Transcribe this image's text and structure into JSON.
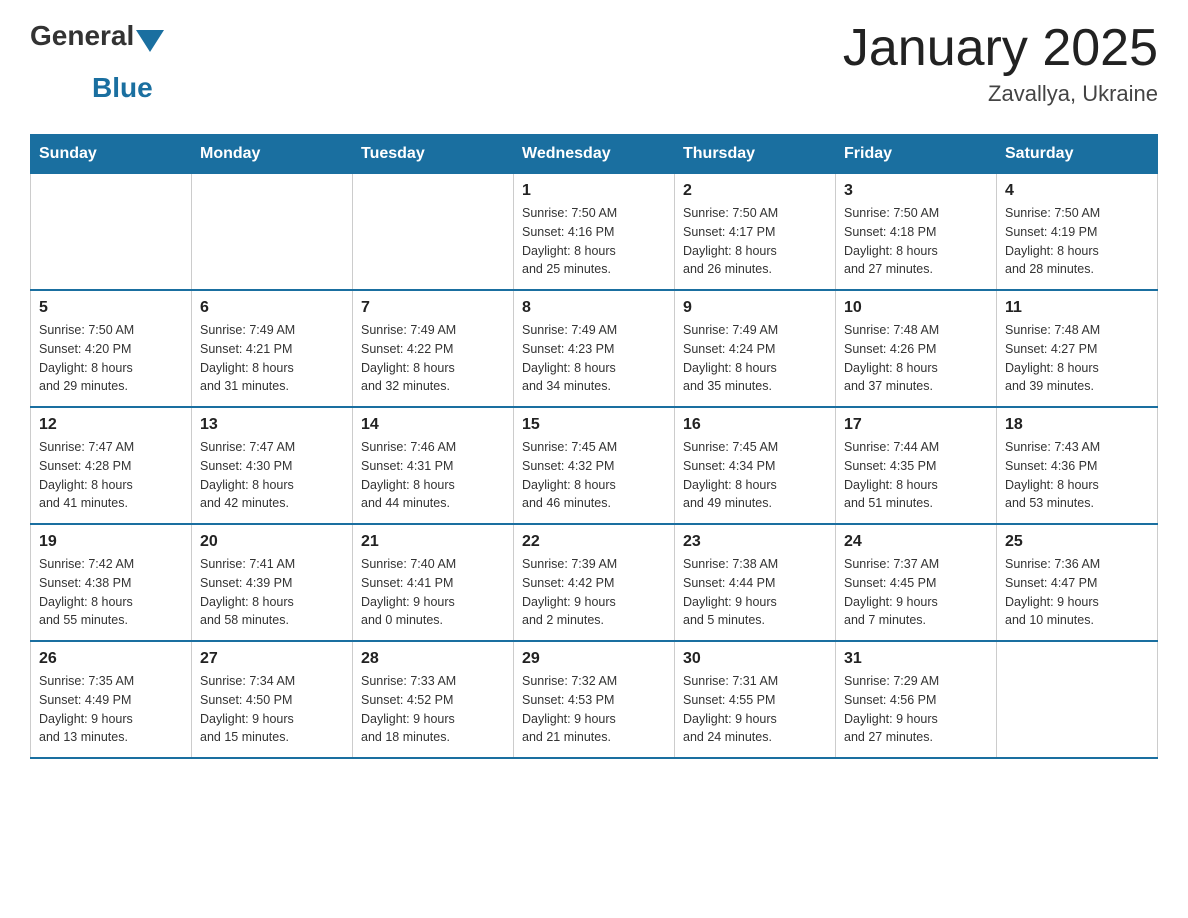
{
  "logo": {
    "general": "General",
    "triangle_color": "#1a6fa0",
    "blue": "Blue"
  },
  "title": "January 2025",
  "subtitle": "Zavallya, Ukraine",
  "days_of_week": [
    "Sunday",
    "Monday",
    "Tuesday",
    "Wednesday",
    "Thursday",
    "Friday",
    "Saturday"
  ],
  "weeks": [
    [
      {
        "day": "",
        "info": ""
      },
      {
        "day": "",
        "info": ""
      },
      {
        "day": "",
        "info": ""
      },
      {
        "day": "1",
        "info": "Sunrise: 7:50 AM\nSunset: 4:16 PM\nDaylight: 8 hours\nand 25 minutes."
      },
      {
        "day": "2",
        "info": "Sunrise: 7:50 AM\nSunset: 4:17 PM\nDaylight: 8 hours\nand 26 minutes."
      },
      {
        "day": "3",
        "info": "Sunrise: 7:50 AM\nSunset: 4:18 PM\nDaylight: 8 hours\nand 27 minutes."
      },
      {
        "day": "4",
        "info": "Sunrise: 7:50 AM\nSunset: 4:19 PM\nDaylight: 8 hours\nand 28 minutes."
      }
    ],
    [
      {
        "day": "5",
        "info": "Sunrise: 7:50 AM\nSunset: 4:20 PM\nDaylight: 8 hours\nand 29 minutes."
      },
      {
        "day": "6",
        "info": "Sunrise: 7:49 AM\nSunset: 4:21 PM\nDaylight: 8 hours\nand 31 minutes."
      },
      {
        "day": "7",
        "info": "Sunrise: 7:49 AM\nSunset: 4:22 PM\nDaylight: 8 hours\nand 32 minutes."
      },
      {
        "day": "8",
        "info": "Sunrise: 7:49 AM\nSunset: 4:23 PM\nDaylight: 8 hours\nand 34 minutes."
      },
      {
        "day": "9",
        "info": "Sunrise: 7:49 AM\nSunset: 4:24 PM\nDaylight: 8 hours\nand 35 minutes."
      },
      {
        "day": "10",
        "info": "Sunrise: 7:48 AM\nSunset: 4:26 PM\nDaylight: 8 hours\nand 37 minutes."
      },
      {
        "day": "11",
        "info": "Sunrise: 7:48 AM\nSunset: 4:27 PM\nDaylight: 8 hours\nand 39 minutes."
      }
    ],
    [
      {
        "day": "12",
        "info": "Sunrise: 7:47 AM\nSunset: 4:28 PM\nDaylight: 8 hours\nand 41 minutes."
      },
      {
        "day": "13",
        "info": "Sunrise: 7:47 AM\nSunset: 4:30 PM\nDaylight: 8 hours\nand 42 minutes."
      },
      {
        "day": "14",
        "info": "Sunrise: 7:46 AM\nSunset: 4:31 PM\nDaylight: 8 hours\nand 44 minutes."
      },
      {
        "day": "15",
        "info": "Sunrise: 7:45 AM\nSunset: 4:32 PM\nDaylight: 8 hours\nand 46 minutes."
      },
      {
        "day": "16",
        "info": "Sunrise: 7:45 AM\nSunset: 4:34 PM\nDaylight: 8 hours\nand 49 minutes."
      },
      {
        "day": "17",
        "info": "Sunrise: 7:44 AM\nSunset: 4:35 PM\nDaylight: 8 hours\nand 51 minutes."
      },
      {
        "day": "18",
        "info": "Sunrise: 7:43 AM\nSunset: 4:36 PM\nDaylight: 8 hours\nand 53 minutes."
      }
    ],
    [
      {
        "day": "19",
        "info": "Sunrise: 7:42 AM\nSunset: 4:38 PM\nDaylight: 8 hours\nand 55 minutes."
      },
      {
        "day": "20",
        "info": "Sunrise: 7:41 AM\nSunset: 4:39 PM\nDaylight: 8 hours\nand 58 minutes."
      },
      {
        "day": "21",
        "info": "Sunrise: 7:40 AM\nSunset: 4:41 PM\nDaylight: 9 hours\nand 0 minutes."
      },
      {
        "day": "22",
        "info": "Sunrise: 7:39 AM\nSunset: 4:42 PM\nDaylight: 9 hours\nand 2 minutes."
      },
      {
        "day": "23",
        "info": "Sunrise: 7:38 AM\nSunset: 4:44 PM\nDaylight: 9 hours\nand 5 minutes."
      },
      {
        "day": "24",
        "info": "Sunrise: 7:37 AM\nSunset: 4:45 PM\nDaylight: 9 hours\nand 7 minutes."
      },
      {
        "day": "25",
        "info": "Sunrise: 7:36 AM\nSunset: 4:47 PM\nDaylight: 9 hours\nand 10 minutes."
      }
    ],
    [
      {
        "day": "26",
        "info": "Sunrise: 7:35 AM\nSunset: 4:49 PM\nDaylight: 9 hours\nand 13 minutes."
      },
      {
        "day": "27",
        "info": "Sunrise: 7:34 AM\nSunset: 4:50 PM\nDaylight: 9 hours\nand 15 minutes."
      },
      {
        "day": "28",
        "info": "Sunrise: 7:33 AM\nSunset: 4:52 PM\nDaylight: 9 hours\nand 18 minutes."
      },
      {
        "day": "29",
        "info": "Sunrise: 7:32 AM\nSunset: 4:53 PM\nDaylight: 9 hours\nand 21 minutes."
      },
      {
        "day": "30",
        "info": "Sunrise: 7:31 AM\nSunset: 4:55 PM\nDaylight: 9 hours\nand 24 minutes."
      },
      {
        "day": "31",
        "info": "Sunrise: 7:29 AM\nSunset: 4:56 PM\nDaylight: 9 hours\nand 27 minutes."
      },
      {
        "day": "",
        "info": ""
      }
    ]
  ]
}
